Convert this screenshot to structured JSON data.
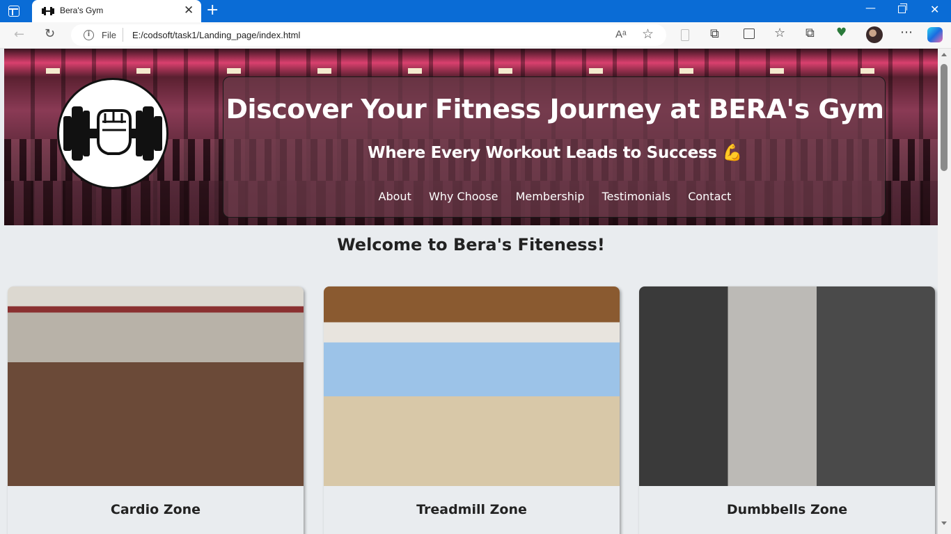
{
  "browser": {
    "tab_title": "Bera's Gym",
    "url_scheme": "File",
    "url": "E:/codsoft/task1/Landing_page/index.html",
    "read_aloud": "Aᵃ",
    "icons": [
      "sidebar-toggle-icon",
      "gym-favicon-icon",
      "close-icon",
      "new-tab-icon",
      "minimize-icon",
      "maximize-icon",
      "close-window-icon",
      "back-icon",
      "refresh-icon",
      "info-icon",
      "read-aloud-icon",
      "favorite-star-icon",
      "device-icon",
      "extensions-icon",
      "split-screen-icon",
      "favorites-icon",
      "collections-icon",
      "browser-essentials-icon",
      "profile-avatar",
      "more-icon",
      "copilot-icon"
    ]
  },
  "hero": {
    "title": "Discover Your Fitness Journey at BERA's Gym",
    "subtitle": "Where Every Workout Leads to Success 💪",
    "nav": [
      "About",
      "Why Choose",
      "Membership",
      "Testimonials",
      "Contact"
    ]
  },
  "welcome": "Welcome to Bera's Fiteness!",
  "cards": [
    {
      "title": "Cardio Zone"
    },
    {
      "title": "Treadmill Zone"
    },
    {
      "title": "Dumbbells Zone"
    }
  ]
}
